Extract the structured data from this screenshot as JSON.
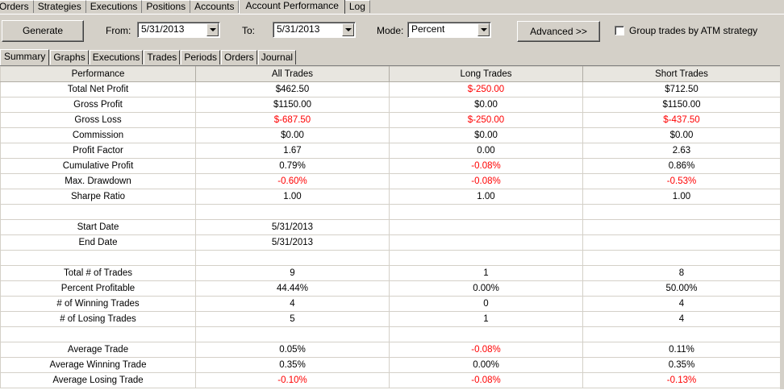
{
  "top_tabs": [
    "Orders",
    "Strategies",
    "Executions",
    "Positions",
    "Accounts",
    "Account Performance",
    "Log"
  ],
  "active_top_tab": "Account Performance",
  "controls": {
    "generate_label": "Generate",
    "from_label": "From:",
    "from_value": "5/31/2013",
    "to_label": "To:",
    "to_value": "5/31/2013",
    "mode_label": "Mode:",
    "mode_value": "Percent",
    "advanced_label": "Advanced >>",
    "group_label": "Group trades by ATM strategy",
    "group_checked": false
  },
  "sub_tabs": [
    "Summary",
    "Graphs",
    "Executions",
    "Trades",
    "Periods",
    "Orders",
    "Journal"
  ],
  "active_sub_tab": "Summary",
  "colors": {
    "negative": "#ff0000",
    "window": "#d4d0c8"
  },
  "table": {
    "headers": [
      "Performance",
      "All Trades",
      "Long Trades",
      "Short Trades"
    ],
    "rows": [
      {
        "label": "Total Net Profit",
        "all": "$462.50",
        "long": "$-250.00",
        "short": "$712.50",
        "neg": [
          false,
          true,
          false
        ]
      },
      {
        "label": "Gross Profit",
        "all": "$1150.00",
        "long": "$0.00",
        "short": "$1150.00",
        "neg": [
          false,
          false,
          false
        ]
      },
      {
        "label": "Gross Loss",
        "all": "$-687.50",
        "long": "$-250.00",
        "short": "$-437.50",
        "neg": [
          true,
          true,
          true
        ]
      },
      {
        "label": "Commission",
        "all": "$0.00",
        "long": "$0.00",
        "short": "$0.00",
        "neg": [
          false,
          false,
          false
        ]
      },
      {
        "label": "Profit Factor",
        "all": "1.67",
        "long": "0.00",
        "short": "2.63",
        "neg": [
          false,
          false,
          false
        ]
      },
      {
        "label": "Cumulative Profit",
        "all": "0.79%",
        "long": "-0.08%",
        "short": "0.86%",
        "neg": [
          false,
          true,
          false
        ]
      },
      {
        "label": "Max. Drawdown",
        "all": "-0.60%",
        "long": "-0.08%",
        "short": "-0.53%",
        "neg": [
          true,
          true,
          true
        ]
      },
      {
        "label": "Sharpe Ratio",
        "all": "1.00",
        "long": "1.00",
        "short": "1.00",
        "neg": [
          false,
          false,
          false
        ]
      },
      {
        "label": "",
        "all": "",
        "long": "",
        "short": "",
        "neg": [
          false,
          false,
          false
        ]
      },
      {
        "label": "Start Date",
        "all": "5/31/2013",
        "long": "",
        "short": "",
        "neg": [
          false,
          false,
          false
        ]
      },
      {
        "label": "End Date",
        "all": "5/31/2013",
        "long": "",
        "short": "",
        "neg": [
          false,
          false,
          false
        ]
      },
      {
        "label": "",
        "all": "",
        "long": "",
        "short": "",
        "neg": [
          false,
          false,
          false
        ]
      },
      {
        "label": "Total # of Trades",
        "all": "9",
        "long": "1",
        "short": "8",
        "neg": [
          false,
          false,
          false
        ]
      },
      {
        "label": "Percent Profitable",
        "all": "44.44%",
        "long": "0.00%",
        "short": "50.00%",
        "neg": [
          false,
          false,
          false
        ]
      },
      {
        "label": "# of Winning Trades",
        "all": "4",
        "long": "0",
        "short": "4",
        "neg": [
          false,
          false,
          false
        ]
      },
      {
        "label": "# of Losing Trades",
        "all": "5",
        "long": "1",
        "short": "4",
        "neg": [
          false,
          false,
          false
        ]
      },
      {
        "label": "",
        "all": "",
        "long": "",
        "short": "",
        "neg": [
          false,
          false,
          false
        ]
      },
      {
        "label": "Average Trade",
        "all": "0.05%",
        "long": "-0.08%",
        "short": "0.11%",
        "neg": [
          false,
          true,
          false
        ]
      },
      {
        "label": "Average Winning Trade",
        "all": "0.35%",
        "long": "0.00%",
        "short": "0.35%",
        "neg": [
          false,
          false,
          false
        ]
      },
      {
        "label": "Average Losing Trade",
        "all": "-0.10%",
        "long": "-0.08%",
        "short": "-0.13%",
        "neg": [
          true,
          true,
          true
        ]
      }
    ]
  }
}
